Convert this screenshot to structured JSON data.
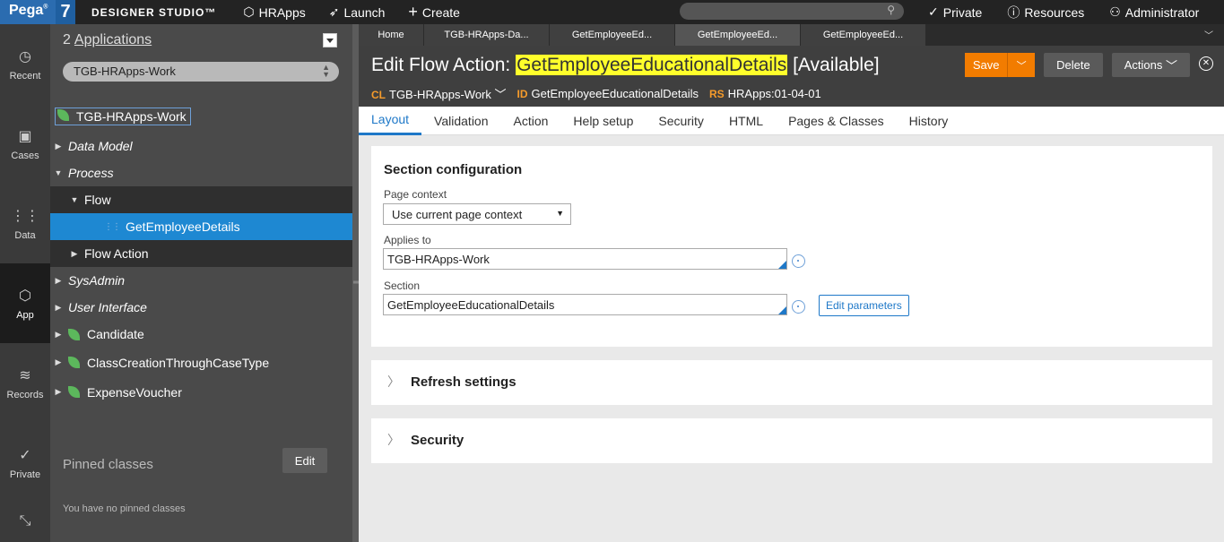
{
  "topbar": {
    "brand": "Pega",
    "brand_mark": "®",
    "version": "7",
    "studio": "DESIGNER STUDIO™",
    "nav": [
      {
        "icon": "cube-icon",
        "label": "HRApps"
      },
      {
        "icon": "rocket-icon",
        "label": "Launch"
      },
      {
        "icon": "plus-icon",
        "label": "Create"
      }
    ],
    "right": [
      {
        "icon": "check-icon",
        "label": "Private"
      },
      {
        "icon": "info-icon",
        "label": "Resources"
      },
      {
        "icon": "user-icon",
        "label": "Administrator"
      }
    ]
  },
  "rail": {
    "items": [
      {
        "icon": "clock-icon",
        "label": "Recent"
      },
      {
        "icon": "briefcase-icon",
        "label": "Cases"
      },
      {
        "icon": "grid-icon",
        "label": "Data"
      },
      {
        "icon": "cube-icon",
        "label": "App"
      },
      {
        "icon": "layers-icon",
        "label": "Records"
      },
      {
        "icon": "check-icon",
        "label": "Private"
      }
    ]
  },
  "explorer": {
    "count": "2",
    "apps_link": "Applications",
    "selected_app": "TGB-HRApps-Work",
    "root": "TGB-HRApps-Work",
    "tree": {
      "data_model": "Data Model",
      "process": "Process",
      "flow": "Flow",
      "flow_item": "GetEmployeeDetails",
      "flow_action": "Flow Action",
      "sysadmin": "SysAdmin",
      "user_interface": "User Interface",
      "candidate": "Candidate",
      "class_creation": "ClassCreationThroughCaseType",
      "expense": "ExpenseVoucher"
    },
    "pinned_title": "Pinned classes",
    "edit_label": "Edit",
    "no_pinned": "You have no pinned classes"
  },
  "doctabs": [
    "Home",
    "TGB-HRApps-Da...",
    "GetEmployeeEd...",
    "GetEmployeeEd...",
    "GetEmployeeEd..."
  ],
  "header": {
    "title_prefix": "Edit Flow Action: ",
    "rule_name": "GetEmployeeEducationalDetails",
    "status": " [Available]",
    "cl_key": "CL",
    "cl_val": "TGB-HRApps-Work",
    "id_key": "ID",
    "id_val": "GetEmployeeEducationalDetails",
    "rs_key": "RS",
    "rs_val": "HRApps:01-04-01",
    "save": "Save",
    "delete": "Delete",
    "actions": "Actions"
  },
  "ruletabs": [
    "Layout",
    "Validation",
    "Action",
    "Help setup",
    "Security",
    "HTML",
    "Pages & Classes",
    "History"
  ],
  "section_config": {
    "title": "Section configuration",
    "page_context_label": "Page context",
    "page_context_value": "Use current page context",
    "applies_to_label": "Applies to",
    "applies_to_value": "TGB-HRApps-Work",
    "section_label": "Section",
    "section_value": "GetEmployeeEducationalDetails",
    "edit_params": "Edit parameters"
  },
  "refresh_settings": "Refresh settings",
  "security": "Security"
}
